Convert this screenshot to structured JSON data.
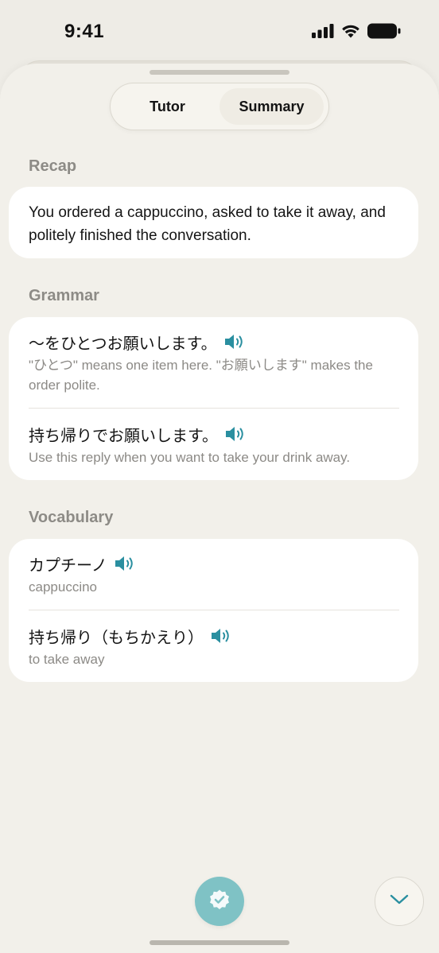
{
  "status_bar": {
    "time": "9:41",
    "icons": [
      "cellular-signal-icon",
      "wifi-icon",
      "battery-icon"
    ]
  },
  "segmented": {
    "tabs": [
      {
        "label": "Tutor",
        "active": false
      },
      {
        "label": "Summary",
        "active": true
      }
    ]
  },
  "recap": {
    "label": "Recap",
    "text": "You ordered a cappuccino, asked to take it away, and politely finished the conversation."
  },
  "grammar": {
    "label": "Grammar",
    "items": [
      {
        "title": "〜をひとつお願いします。",
        "description": "\"ひとつ\" means one item here. \"お願いします\" makes the order polite."
      },
      {
        "title": "持ち帰りでお願いします。",
        "description": "Use this reply when you want to take your drink away."
      }
    ]
  },
  "vocabulary": {
    "label": "Vocabulary",
    "items": [
      {
        "title": "カプチーノ",
        "description": "cappuccino"
      },
      {
        "title": "持ち帰り（もちかえり）",
        "description": "to take away"
      }
    ]
  },
  "colors": {
    "accent_teal": "#2a8fa0",
    "check_button": "#7fc2c5",
    "background": "#eeece6",
    "card": "#ffffff",
    "muted_text": "#8c8a86"
  },
  "bottom_actions": {
    "primary_icon": "verified-check-badge-icon",
    "secondary_icon": "chevron-down-icon"
  }
}
